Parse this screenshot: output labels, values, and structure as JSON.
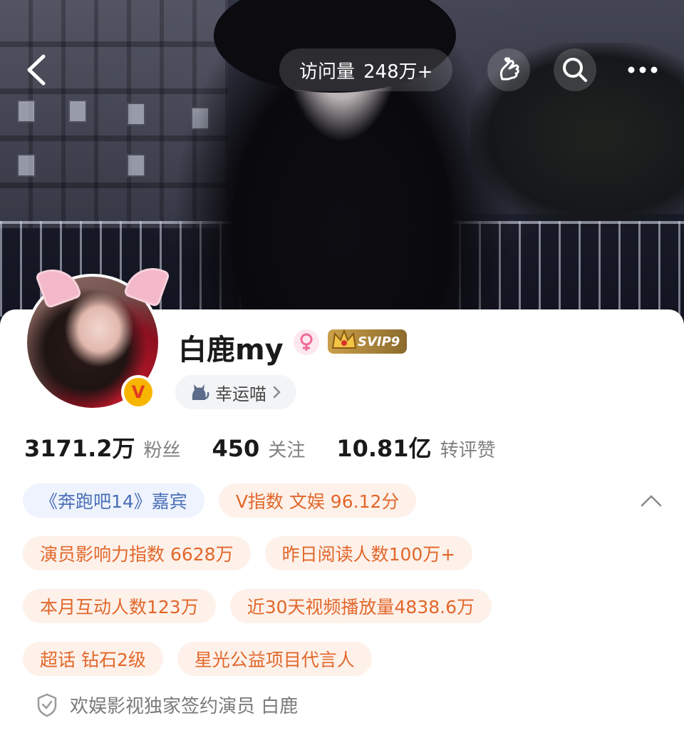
{
  "header": {
    "visits_label": "访问量",
    "visits_value": "248万+",
    "back_icon": "back-arrow-icon",
    "gesture_icon": "finger-heart-icon",
    "search_icon": "search-icon",
    "more_icon": "more-dots-icon"
  },
  "profile": {
    "username": "白鹿my",
    "gender": "female",
    "svip_badge": "SVIP9",
    "title_badge": "幸运喵",
    "verified_badge": "V",
    "colors": {
      "orange_tag_text": "#e2672a",
      "orange_tag_bg": "#fdf1ea",
      "blue_tag_text": "#4a6fb8",
      "blue_tag_bg": "#eef3fd",
      "svip_gold": "#caa04a",
      "verified_yellow": "#f7b500"
    }
  },
  "stats": [
    {
      "value": "3171.2万",
      "label": "粉丝"
    },
    {
      "value": "450",
      "label": "关注"
    },
    {
      "value": "10.81亿",
      "label": "转评赞"
    }
  ],
  "tags": {
    "row1": [
      "《奔跑吧14》嘉宾",
      "V指数 文娱 96.12分"
    ],
    "row2": [
      "演员影响力指数 6628万",
      "昨日阅读人数100万+"
    ],
    "row3": [
      "本月互动人数123万",
      "近30天视频播放量4838.6万"
    ],
    "row4": [
      "超话 钻石2级",
      "星光公益项目代言人"
    ]
  },
  "verification": {
    "text": "欢娱影视独家签约演员 白鹿",
    "icon": "shield-check-icon"
  }
}
